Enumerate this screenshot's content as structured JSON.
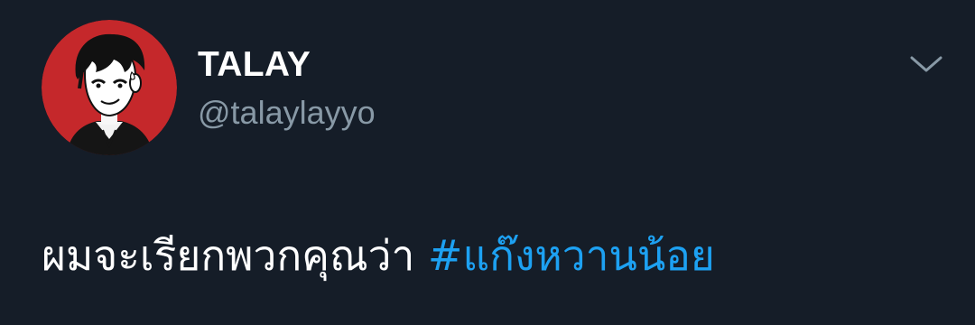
{
  "user": {
    "display_name": "TALAY",
    "handle": "@talaylayyo",
    "avatar_icon": "avatar-illustration",
    "avatar_bg_color": "#c5282b"
  },
  "tweet": {
    "text": "ผมจะเรียกพวกคุณว่า",
    "hashtag": "#แก๊งหวานน้อย",
    "hashtag_color": "#1da1f2"
  },
  "menu": {
    "icon": "chevron-down-icon"
  },
  "colors": {
    "background": "#151d28",
    "primary_text": "#ffffff",
    "secondary_text": "#8899a6"
  }
}
